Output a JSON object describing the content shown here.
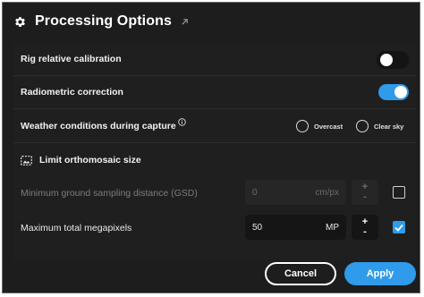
{
  "dialog": {
    "title": "Processing Options",
    "icons": {
      "title": "gear-icon",
      "external": "external-link-icon"
    }
  },
  "options": {
    "rig_calibration": {
      "label": "Rig relative calibration",
      "enabled": false
    },
    "radiometric": {
      "label": "Radiometric correction",
      "enabled": true
    },
    "weather": {
      "label": "Weather conditions during capture",
      "info_icon": "info-icon",
      "choices": [
        "Overcast",
        "Clear sky"
      ],
      "selected": null
    },
    "limit_ortho": {
      "label": "Limit orthomosaic size",
      "icon": "image-icon"
    },
    "gsd": {
      "label": "Minimum ground sampling distance (GSD)",
      "value": "0",
      "unit": "cm/px",
      "enabled": false,
      "stepper_plus": "+",
      "stepper_minus": "-"
    },
    "megapixels": {
      "label": "Maximum total megapixels",
      "value": "50",
      "unit": "MP",
      "enabled": true,
      "stepper_plus": "+",
      "stepper_minus": "-"
    }
  },
  "buttons": {
    "cancel": "Cancel",
    "apply": "Apply"
  },
  "colors": {
    "accent": "#2f9bea",
    "background": "#1d1d1d"
  }
}
